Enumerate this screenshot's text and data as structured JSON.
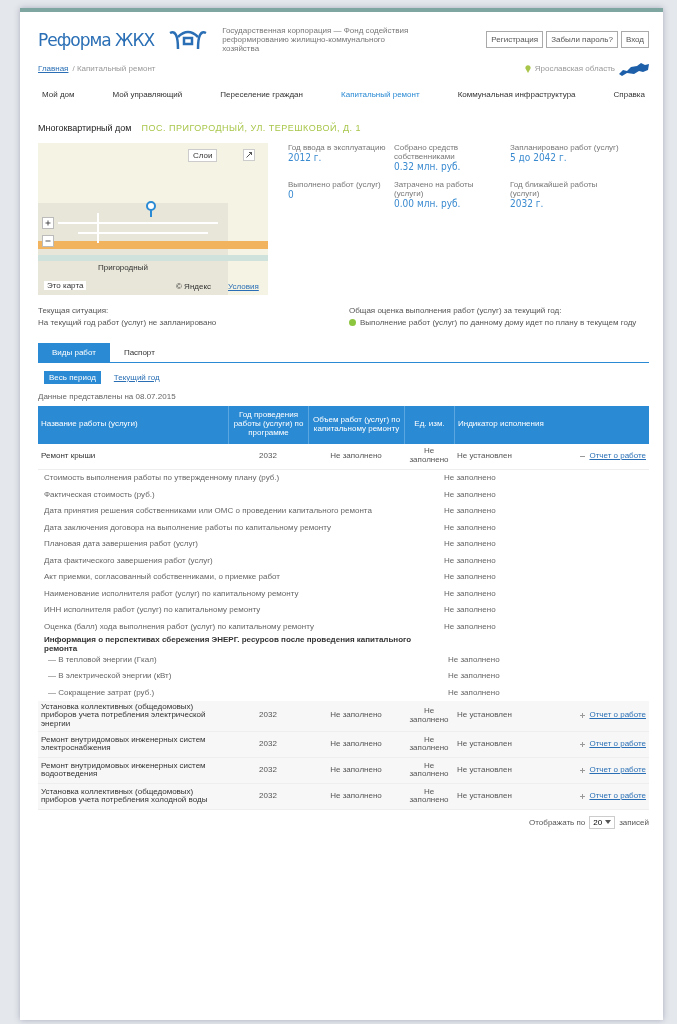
{
  "header": {
    "logo": "Реформа ЖКХ",
    "tagline": "Государственная корпорация — Фонд содействия реформированию жилищно-коммунального хозяйства",
    "buttons": [
      "Регистрация",
      "Забыли пароль?",
      "Вход"
    ]
  },
  "breadcrumbs": [
    {
      "label": "Главная",
      "kind": "link"
    },
    {
      "label": "/ Капитальный ремонт",
      "kind": "text"
    }
  ],
  "region": "Ярославская область",
  "nav": [
    {
      "label": "Мой дом",
      "selected": false
    },
    {
      "label": "Мой управляющий",
      "selected": false
    },
    {
      "label": "Переселение граждан",
      "selected": false
    },
    {
      "label": "Капитальный ремонт",
      "selected": true
    },
    {
      "label": "Коммунальная инфраструктура",
      "selected": false
    },
    {
      "label": "Справка",
      "selected": false
    }
  ],
  "house": {
    "label": "Многоквартирный дом",
    "address": "ПОС. ПРИГОРОДНЫЙ, УЛ. ТЕРЕШКОВОЙ, Д. 1"
  },
  "map": {
    "layers_button": "Слои",
    "place_label": "Пригородный",
    "open_link": "Это карта",
    "copyright": "© Яндекс",
    "terms_link": "Условия"
  },
  "stats": [
    {
      "label": "Год ввода в эксплуатацию",
      "value": "2012 г."
    },
    {
      "label": "Собрано средств собственниками",
      "value": "0.32 млн. руб."
    },
    {
      "label": "Запланировано работ (услуг)",
      "value": "5 до 2042 г."
    },
    {
      "label": "Выполнено работ (услуг)",
      "value": "0"
    },
    {
      "label": "Затрачено на работы (услуги)",
      "value": "0.00 млн. руб."
    },
    {
      "label": "Год ближайшей работы (услуги)",
      "value": "2032 г."
    }
  ],
  "situation": {
    "title": "Текущая ситуация:",
    "text": "На текущий год работ (услуг) не запланировано"
  },
  "assessment": {
    "title": "Общая оценка выполнения работ (услуг) за текущий год:",
    "text": "Выполнение работ (услуг) по данному дому идет по плану в текущем году",
    "color": "#8cc63f"
  },
  "tabs": [
    {
      "label": "Виды работ",
      "selected": true
    },
    {
      "label": "Паспорт",
      "selected": false
    }
  ],
  "periods": [
    {
      "label": "Весь период",
      "selected": true
    },
    {
      "label": "Текущий год",
      "selected": false
    }
  ],
  "data_date": "Данные представлены на 08.07.2015",
  "table": {
    "columns": [
      "Название работы (услуги)",
      "Год проведения работы (услуги) по программе",
      "Объем работ (услуг) по капитальному ремонту",
      "Ед. изм.",
      "Индикатор исполнения"
    ],
    "rows": [
      {
        "name": "Ремонт крыши",
        "year": "2032",
        "volume": "Не заполнено",
        "unit": "Не заполнено",
        "indicator": "Не установлен",
        "link": "Отчет о работе",
        "expanded": true,
        "details": [
          {
            "kind": "item",
            "label": "Стоимость выполнения работы по утвержденному плану (руб.)",
            "value": "Не заполнено"
          },
          {
            "kind": "item",
            "label": "Фактическая стоимость (руб.)",
            "value": "Не заполнено"
          },
          {
            "kind": "item",
            "label": "Дата принятия решения собственниками или ОМС о проведении капитального ремонта",
            "value": "Не заполнено"
          },
          {
            "kind": "item",
            "label": "Дата заключения договора на выполнение работы по капитальному ремонту",
            "value": "Не заполнено"
          },
          {
            "kind": "item",
            "label": "Плановая дата завершения работ (услуг)",
            "value": "Не заполнено"
          },
          {
            "kind": "item",
            "label": "Дата фактического завершения работ (услуг)",
            "value": "Не заполнено"
          },
          {
            "kind": "item",
            "label": "Акт приемки, согласованный собственниками, о приемке работ",
            "value": "Не заполнено"
          },
          {
            "kind": "item",
            "label": "Наименование исполнителя работ (услуг) по капитальному ремонту",
            "value": "Не заполнено"
          },
          {
            "kind": "item",
            "label": "ИНН исполнителя работ (услуг) по капитальному ремонту",
            "value": "Не заполнено"
          },
          {
            "kind": "item",
            "label": "Оценка (балл) хода выполнения работ (услуг) по капитальному ремонту",
            "value": "Не заполнено"
          },
          {
            "kind": "section",
            "label": "Информация о перспективах сбережения ЭНЕРГ. ресурсов после проведения капитального ремонта"
          },
          {
            "kind": "sub",
            "label": "— В тепловой энергии (Гкал)",
            "value": "Не заполнено"
          },
          {
            "kind": "sub",
            "label": "— В электрической энергии (кВт)",
            "value": "Не заполнено"
          },
          {
            "kind": "sub",
            "label": "— Сокращение затрат (руб.)",
            "value": "Не заполнено"
          }
        ]
      },
      {
        "name": "Установка коллективных (общедомовых) приборов учета потребления электрической энергии",
        "year": "2032",
        "volume": "Не заполнено",
        "unit": "Не заполнено",
        "indicator": "Не установлен",
        "link": "Отчет о работе",
        "expanded": false
      },
      {
        "name": "Ремонт внутридомовых инженерных систем электроснабжения",
        "year": "2032",
        "volume": "Не заполнено",
        "unit": "Не заполнено",
        "indicator": "Не установлен",
        "link": "Отчет о работе",
        "expanded": false
      },
      {
        "name": "Ремонт внутридомовых инженерных систем водоотведения",
        "year": "2032",
        "volume": "Не заполнено",
        "unit": "Не заполнено",
        "indicator": "Не установлен",
        "link": "Отчет о работе",
        "expanded": false
      },
      {
        "name": "Установка коллективных (общедомовых) приборов учета потребления холодной воды",
        "year": "2032",
        "volume": "Не заполнено",
        "unit": "Не заполнено",
        "indicator": "Не установлен",
        "link": "Отчет о работе",
        "expanded": false
      }
    ]
  },
  "pager": {
    "label": "Отображать по",
    "value": "20",
    "suffix": "записей"
  }
}
